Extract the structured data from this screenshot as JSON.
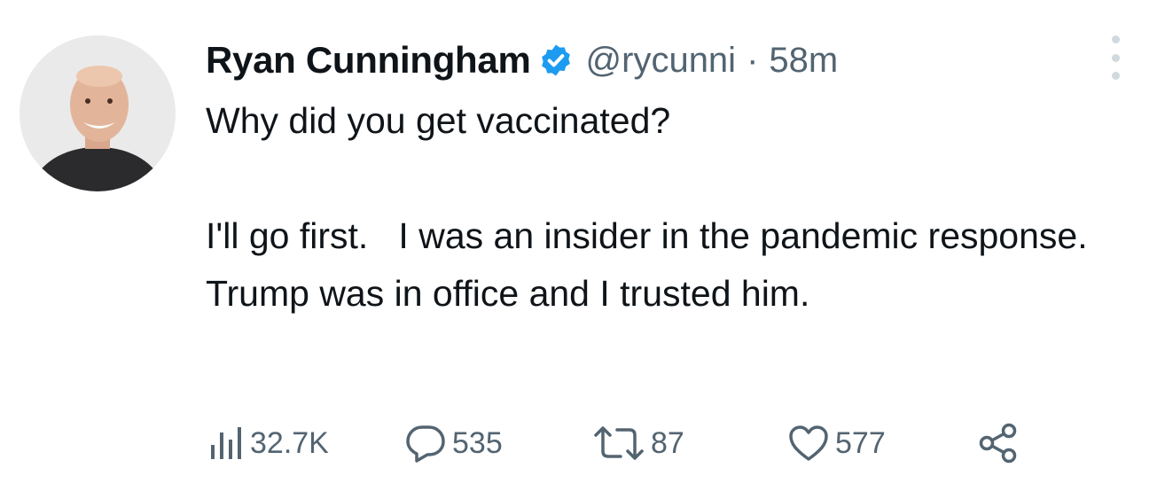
{
  "tweet": {
    "display_name": "Ryan Cunningham",
    "handle": "@rycunni",
    "separator": "·",
    "time": "58m",
    "paragraph_1": "Why did you get vaccinated?",
    "paragraph_2": "I'll go first.   I was an insider in the pandemic response.   Trump was in office and I trusted him.",
    "stats": {
      "views": "32.7K",
      "replies": "535",
      "retweets": "87",
      "likes": "577"
    }
  },
  "icons": {
    "verified": "verified-badge-icon",
    "more": "more-dots-icon",
    "views": "views-bar-chart-icon",
    "reply": "speech-bubble-icon",
    "retweet": "retweet-arrows-icon",
    "like": "heart-icon",
    "share": "share-icon"
  },
  "colors": {
    "text": "#0f1419",
    "secondary": "#536471",
    "verified": "#1d9bf0"
  }
}
